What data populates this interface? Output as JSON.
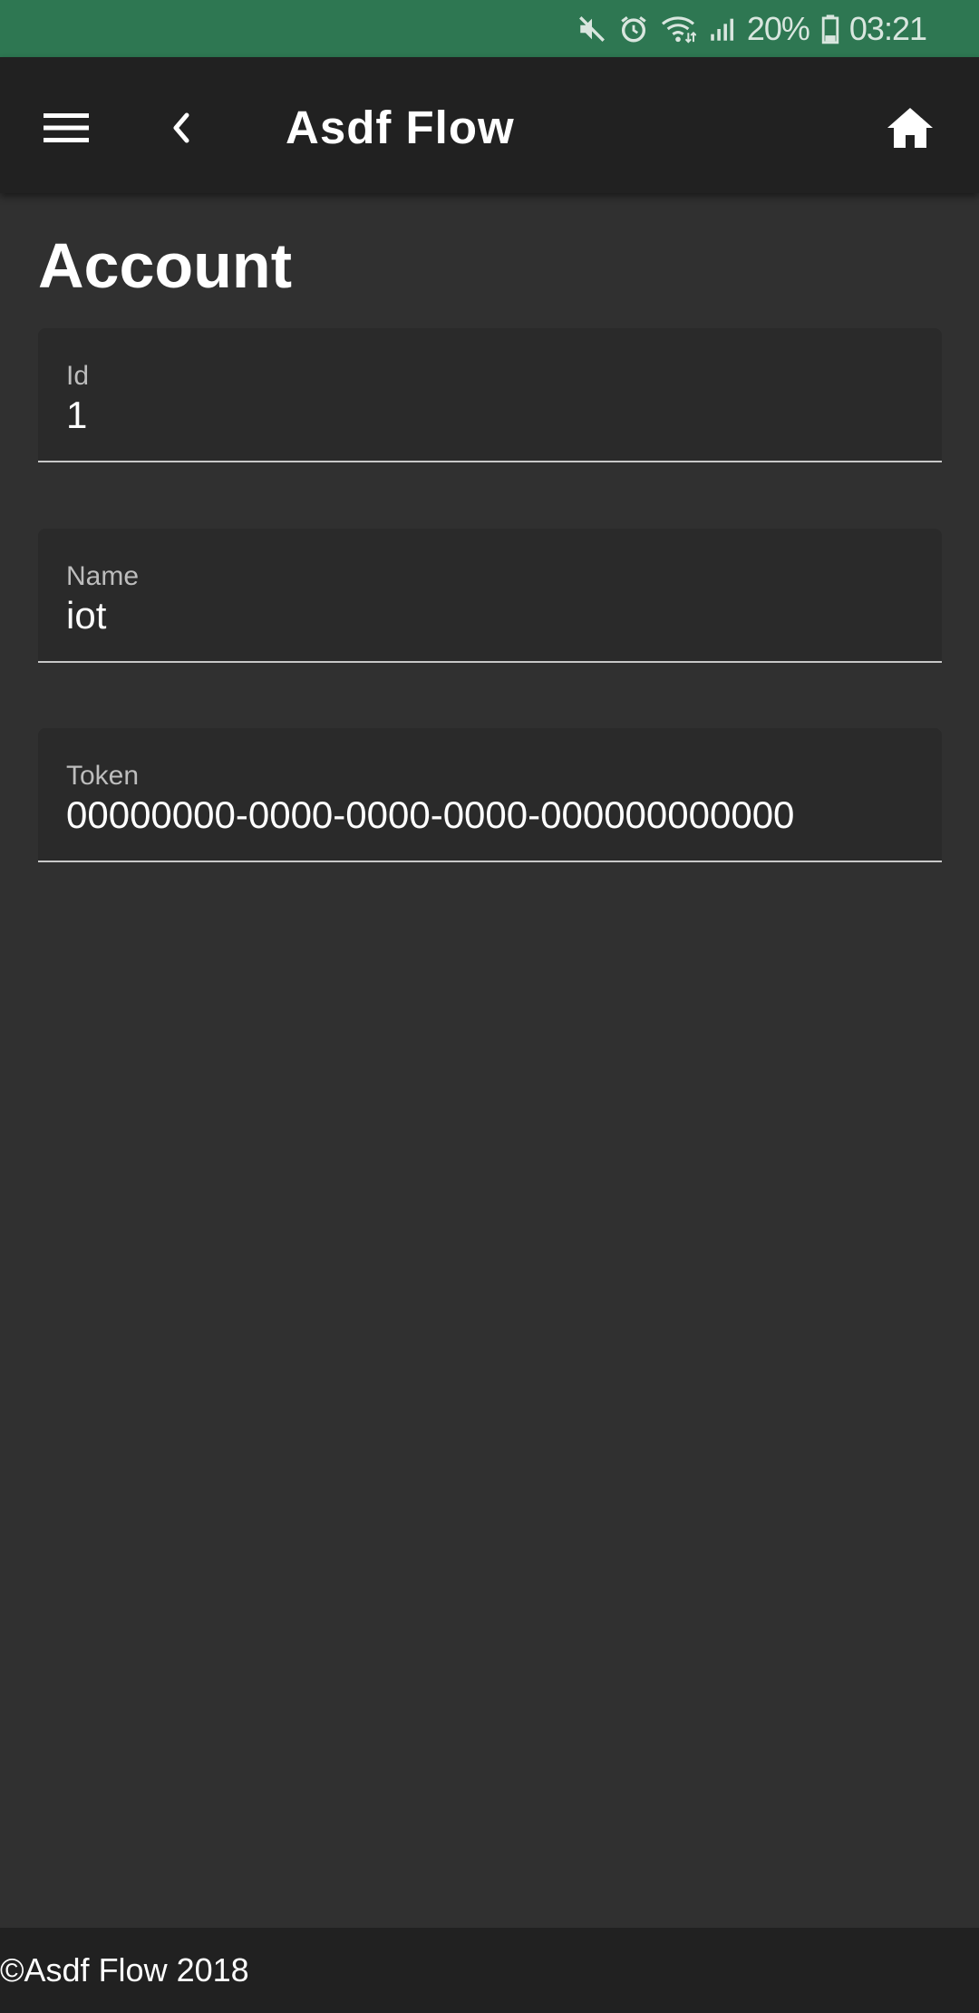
{
  "status_bar": {
    "battery": "20%",
    "time": "03:21",
    "icons": [
      "mute-icon",
      "alarm-icon",
      "wifi-icon",
      "signal-icon",
      "battery-icon"
    ]
  },
  "app_bar": {
    "title": "Asdf Flow",
    "icons": {
      "menu": "menu-icon",
      "back": "chevron-left-icon",
      "home": "home-icon"
    }
  },
  "page": {
    "title": "Account"
  },
  "fields": {
    "id": {
      "label": "Id",
      "value": "1"
    },
    "name": {
      "label": "Name",
      "value": "iot"
    },
    "token": {
      "label": "Token",
      "value": "00000000-0000-0000-0000-000000000000"
    }
  },
  "footer": {
    "text": "©Asdf Flow 2018"
  },
  "colors": {
    "status_bar": "#2e7752",
    "app_bar": "#212121",
    "background": "#303030",
    "field_bg": "#2a2a2a"
  }
}
